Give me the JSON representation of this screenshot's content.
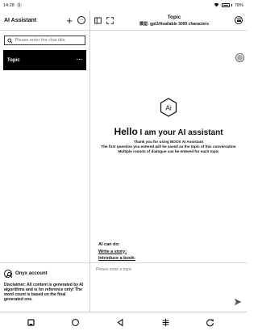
{
  "status_bar": {
    "time": "14:28",
    "battery": "78%"
  },
  "sidebar": {
    "title": "AI Assistant",
    "search_placeholder": "Please enter the chat title",
    "topics": [
      {
        "label": "Topic"
      }
    ],
    "account_name": "Onyx account",
    "disclaimer": "Disclaimer: All content is generated by AI algorithms and is for reference only! The word count is based on the final generated one."
  },
  "main": {
    "title": "Topic",
    "subtitle": "模型: gpt3/Available 3000 characters",
    "logo_text": "Ai",
    "hello_word": "Hello",
    "hello_rest": " I am your AI assistant",
    "welcome_lines": [
      "Thank you for using BOOX AI Assistant",
      "The first question you entered will be saved as the topic of this conversation",
      "Multiple rounds of dialogue can be entered for each topic"
    ],
    "can_do_label": "AI can do:",
    "suggestions": [
      "Write a story:",
      "Introduce a book:"
    ],
    "input_placeholder": "Please enter a topic"
  },
  "navbar": {
    "icons": [
      "square-back-icon",
      "circle-home-icon",
      "triangle-back-icon",
      "menu-adjust-icon",
      "refresh-icon"
    ]
  }
}
